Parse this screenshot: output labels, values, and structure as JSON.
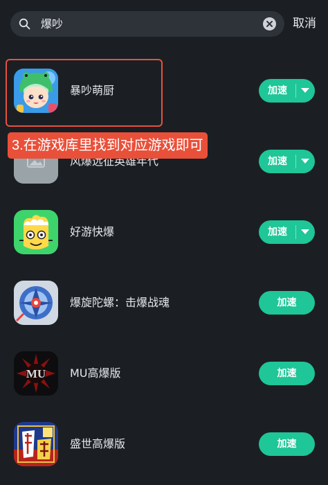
{
  "search": {
    "query": "爆吵",
    "cancel_label": "取消"
  },
  "apps": [
    {
      "name": "暴吵萌厨",
      "button_label": "加速",
      "has_dropdown": true,
      "icon": "chef-girl-game-icon"
    },
    {
      "name": "风爆远征英雄年代",
      "button_label": "加速",
      "has_dropdown": true,
      "icon": "placeholder-image-icon"
    },
    {
      "name": "好游快爆",
      "button_label": "加速",
      "has_dropdown": true,
      "icon": "cartoon-face-icon"
    },
    {
      "name": "爆旋陀螺：击爆战魂",
      "button_label": "加速",
      "has_dropdown": false,
      "icon": "spinning-top-icon"
    },
    {
      "name": "MU高爆版",
      "button_label": "加速",
      "has_dropdown": false,
      "icon": "mu-logo-icon"
    },
    {
      "name": "盛世高爆版",
      "button_label": "加速",
      "has_dropdown": false,
      "icon": "chuanshi-logo-icon"
    }
  ],
  "annotation": {
    "text": "3.在游戏库里找到对应游戏即可"
  },
  "colors": {
    "background": "#1b1f24",
    "accent": "#1fc697",
    "annotation": "#e9503a"
  }
}
